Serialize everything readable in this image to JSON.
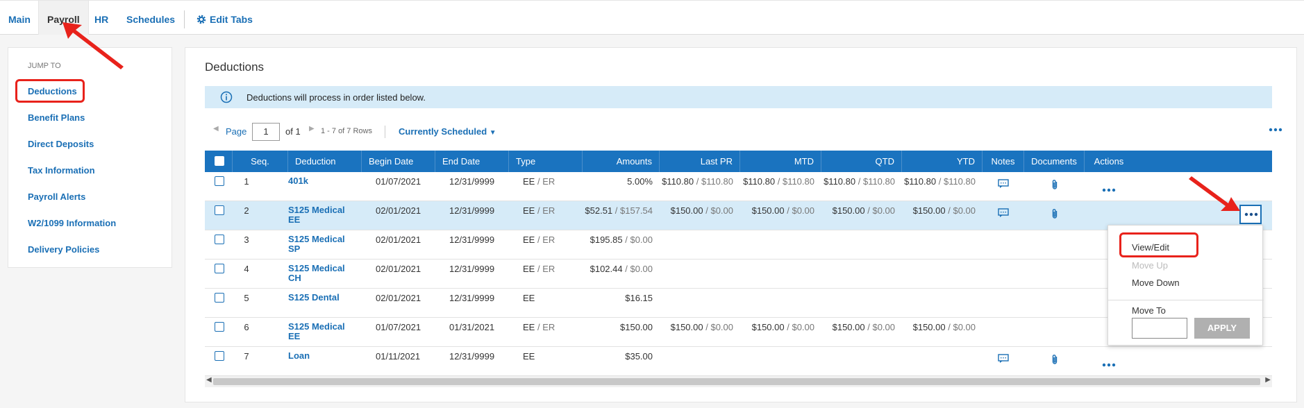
{
  "tabs": [
    {
      "label": "Main"
    },
    {
      "label": "Payroll"
    },
    {
      "label": "HR"
    },
    {
      "label": "Schedules"
    }
  ],
  "edit_tabs_label": "Edit Tabs",
  "sidebar": {
    "heading": "JUMP TO",
    "items": [
      {
        "label": "Deductions"
      },
      {
        "label": "Benefit Plans"
      },
      {
        "label": "Direct Deposits"
      },
      {
        "label": "Tax Information"
      },
      {
        "label": "Payroll Alerts"
      },
      {
        "label": "W2/1099 Information"
      },
      {
        "label": "Delivery Policies"
      }
    ]
  },
  "main": {
    "title": "Deductions",
    "info": "Deductions will process in order listed below.",
    "pager": {
      "page_label": "Page",
      "page_value": "1",
      "of": "of 1",
      "rows": "1 - 7 of 7 Rows",
      "filter": "Currently Scheduled"
    },
    "columns": [
      "Seq.",
      "Deduction",
      "Begin Date",
      "End Date",
      "Type",
      "Amounts",
      "Last PR",
      "MTD",
      "QTD",
      "YTD",
      "Notes",
      "Documents",
      "Actions"
    ],
    "rows": [
      {
        "seq": "1",
        "deduction": "401k",
        "begin": "01/07/2021",
        "end": "12/31/9999",
        "type_ee": "EE",
        "type_er": "/ ER",
        "amt": "5.00%",
        "amt_er": "",
        "lastpr": "$110.80",
        "lastpr_er": "/ $110.80",
        "mtd": "$110.80",
        "mtd_er": "/ $110.80",
        "qtd": "$110.80",
        "qtd_er": "/ $110.80",
        "ytd": "$110.80",
        "ytd_er": "/ $110.80"
      },
      {
        "seq": "2",
        "deduction": "S125 Medical EE",
        "begin": "02/01/2021",
        "end": "12/31/9999",
        "type_ee": "EE",
        "type_er": "/ ER",
        "amt": "$52.51",
        "amt_er": "/ $157.54",
        "lastpr": "$150.00",
        "lastpr_er": "/ $0.00",
        "mtd": "$150.00",
        "mtd_er": "/ $0.00",
        "qtd": "$150.00",
        "qtd_er": "/ $0.00",
        "ytd": "$150.00",
        "ytd_er": "/ $0.00"
      },
      {
        "seq": "3",
        "deduction": "S125 Medical SP",
        "begin": "02/01/2021",
        "end": "12/31/9999",
        "type_ee": "EE",
        "type_er": "/ ER",
        "amt": "$195.85",
        "amt_er": "/ $0.00",
        "lastpr": "",
        "lastpr_er": "",
        "mtd": "",
        "mtd_er": "",
        "qtd": "",
        "qtd_er": "",
        "ytd": "",
        "ytd_er": ""
      },
      {
        "seq": "4",
        "deduction": "S125 Medical CH",
        "begin": "02/01/2021",
        "end": "12/31/9999",
        "type_ee": "EE",
        "type_er": "/ ER",
        "amt": "$102.44",
        "amt_er": "/ $0.00",
        "lastpr": "",
        "lastpr_er": "",
        "mtd": "",
        "mtd_er": "",
        "qtd": "",
        "qtd_er": "",
        "ytd": "",
        "ytd_er": ""
      },
      {
        "seq": "5",
        "deduction": "S125 Dental",
        "begin": "02/01/2021",
        "end": "12/31/9999",
        "type_ee": "EE",
        "type_er": "",
        "amt": "$16.15",
        "amt_er": "",
        "lastpr": "",
        "lastpr_er": "",
        "mtd": "",
        "mtd_er": "",
        "qtd": "",
        "qtd_er": "",
        "ytd": "",
        "ytd_er": ""
      },
      {
        "seq": "6",
        "deduction": "S125 Medical EE",
        "begin": "01/07/2021",
        "end": "01/31/2021",
        "type_ee": "EE",
        "type_er": "/ ER",
        "amt": "$150.00",
        "amt_er": "",
        "lastpr": "$150.00",
        "lastpr_er": "/ $0.00",
        "mtd": "$150.00",
        "mtd_er": "/ $0.00",
        "qtd": "$150.00",
        "qtd_er": "/ $0.00",
        "ytd": "$150.00",
        "ytd_er": "/ $0.00"
      },
      {
        "seq": "7",
        "deduction": "Loan",
        "begin": "01/11/2021",
        "end": "12/31/9999",
        "type_ee": "EE",
        "type_er": "",
        "amt": "$35.00",
        "amt_er": "",
        "lastpr": "",
        "lastpr_er": "",
        "mtd": "",
        "mtd_er": "",
        "qtd": "",
        "qtd_er": "",
        "ytd": "",
        "ytd_er": ""
      }
    ]
  },
  "menu": {
    "view_edit": "View/Edit",
    "move_up": "Move Up",
    "move_down": "Move Down",
    "move_to": "Move To",
    "apply": "APPLY"
  },
  "colors": {
    "accent": "#1a6fb5",
    "header": "#1a73bf",
    "info_bg": "#d6ebf8",
    "highlight": "#e8221b"
  }
}
